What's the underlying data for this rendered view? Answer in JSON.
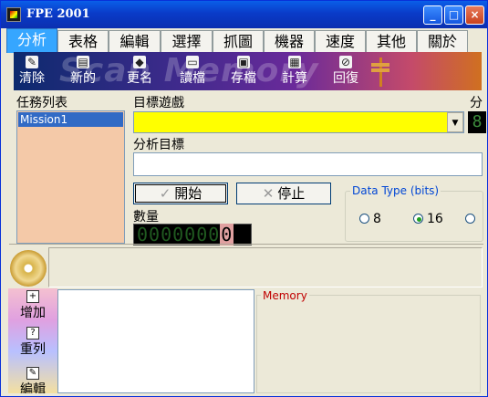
{
  "window": {
    "title": "FPE 2001"
  },
  "titlebar_buttons": {
    "minimize": "_",
    "maximize": "□",
    "close": "×"
  },
  "tabs": [
    "分析",
    "表格",
    "編輯",
    "選擇",
    "抓圖",
    "機器",
    "速度",
    "其他",
    "關於"
  ],
  "toolbar": {
    "watermark": "Scan Memory",
    "items": [
      {
        "label": "清除",
        "icon": "clear-icon"
      },
      {
        "label": "新的",
        "icon": "new-icon"
      },
      {
        "label": "更名",
        "icon": "rename-icon"
      },
      {
        "label": "讀檔",
        "icon": "open-folder-icon"
      },
      {
        "label": "存檔",
        "icon": "save-disk-icon"
      },
      {
        "label": "計算",
        "icon": "calculator-icon"
      },
      {
        "label": "回復",
        "icon": "restore-icon"
      }
    ]
  },
  "left": {
    "list_label": "任務列表",
    "missions": [
      "Mission1"
    ]
  },
  "main": {
    "target_game_label": "目標遊戲",
    "target_game_value": "",
    "analysis_target_label": "分析目標",
    "analysis_target_value": "",
    "side_label_fragment": "分",
    "side_lcd": "8",
    "start_button": "開始",
    "stop_button": "停止",
    "count_label": "數量",
    "count_value": "0000000",
    "count_last_digit": "0"
  },
  "data_type": {
    "title": "Data Type (bits)",
    "options": [
      {
        "label": "8",
        "selected": false
      },
      {
        "label": "16",
        "selected": true
      },
      {
        "label": "",
        "selected": false
      }
    ]
  },
  "bottom": {
    "side_tools": [
      {
        "label": "增加",
        "icon": "add-icon"
      },
      {
        "label": "重列",
        "icon": "relist-icon"
      },
      {
        "label": "編輯",
        "icon": "edit-icon"
      }
    ],
    "memory_title": "Memory"
  }
}
